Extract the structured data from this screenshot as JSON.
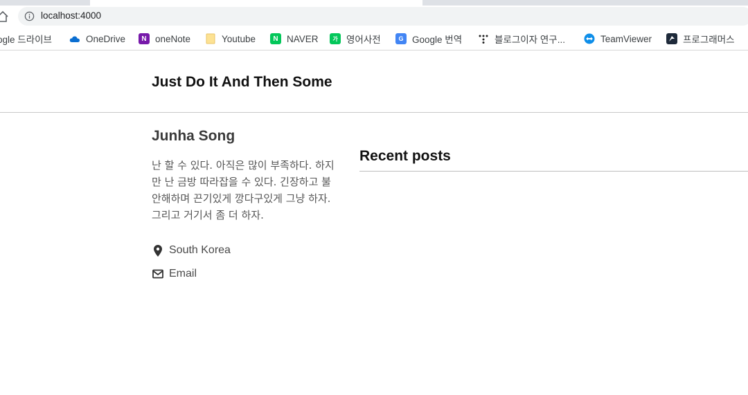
{
  "browser": {
    "url": "localhost:4000",
    "bookmarks": [
      {
        "label": "ogle 드라이브",
        "icon": "google-drive-icon"
      },
      {
        "label": "OneDrive",
        "icon": "onedrive-icon"
      },
      {
        "label": "oneNote",
        "icon": "onenote-icon"
      },
      {
        "label": "Youtube",
        "icon": "folder-icon"
      },
      {
        "label": "NAVER",
        "icon": "naver-icon"
      },
      {
        "label": "영어사전",
        "icon": "naver-dictionary-icon"
      },
      {
        "label": "Google 번역",
        "icon": "google-translate-icon"
      },
      {
        "label": "블로그이자 연구...",
        "icon": "dots-icon"
      },
      {
        "label": "TeamViewer",
        "icon": "teamviewer-icon"
      },
      {
        "label": "프로그래머스",
        "icon": "programmers-icon"
      }
    ]
  },
  "site": {
    "title": "Just Do It And Then Some"
  },
  "author": {
    "name": "Junha Song",
    "bio": "난 할 수 있다. 아직은 많이 부족하다. 하지만 난 금방 따라잡을 수 있다. 긴장하고 불안해하며 끈기있게 깡다구있게 그냥 하자. 그리고 거기서 좀 더 하자.",
    "location": "South Korea",
    "email_label": "Email"
  },
  "main": {
    "section_title": "Recent posts"
  },
  "colors": {
    "naver": "#03c75a",
    "onenote": "#7719aa",
    "onedrive": "#0a6ed1",
    "teamviewer": "#0e8ee9",
    "programmers": "#1e2a3a"
  }
}
